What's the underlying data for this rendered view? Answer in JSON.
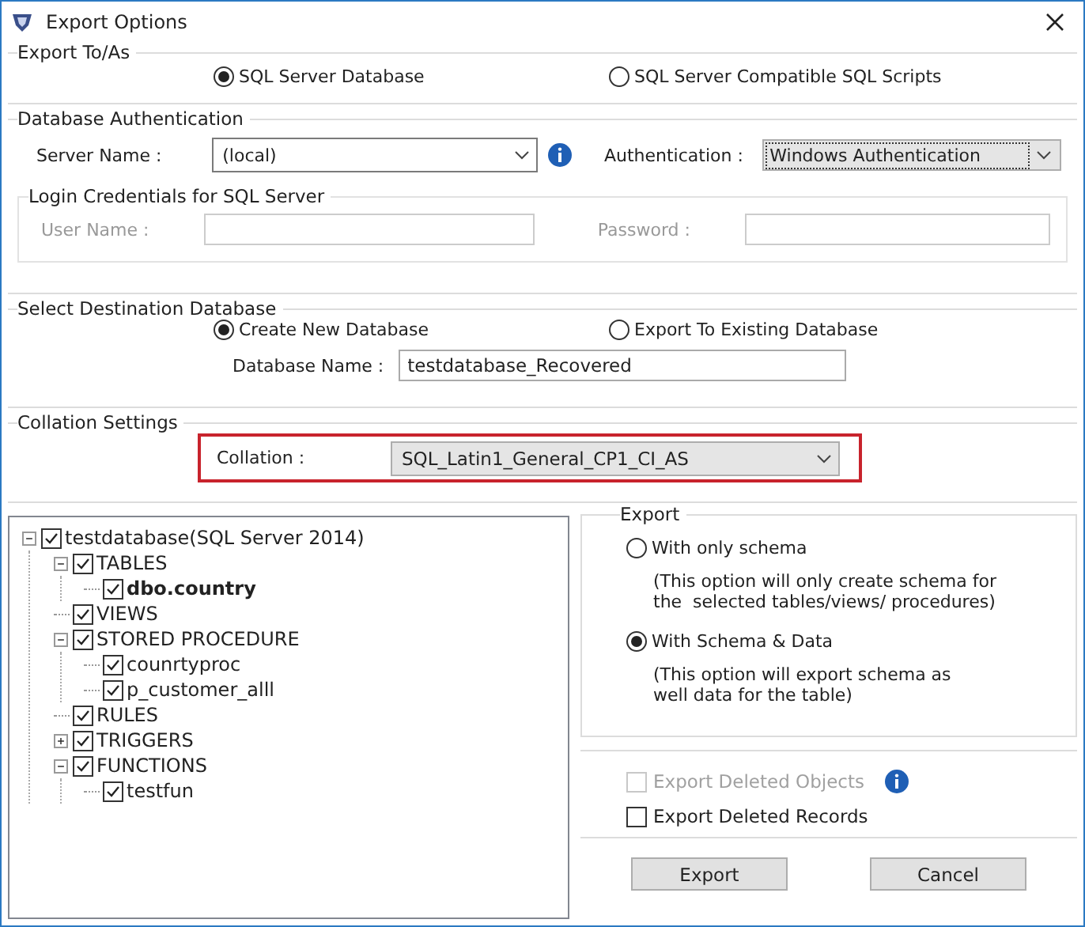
{
  "window": {
    "title": "Export Options"
  },
  "export_to": {
    "label": "Export To/As",
    "options": [
      {
        "label": "SQL Server Database",
        "selected": true
      },
      {
        "label": "SQL Server Compatible SQL Scripts",
        "selected": false
      }
    ]
  },
  "authentication": {
    "label": "Database Authentication",
    "server_name": {
      "label": "Server Name :",
      "value": "(local)"
    },
    "mode": {
      "label": "Authentication :",
      "value": "Windows Authentication"
    },
    "login": {
      "label": "Login Credentials for SQL Server",
      "disabled": true,
      "user_name": {
        "label": "User Name :"
      },
      "password": {
        "label": "Password :"
      }
    }
  },
  "destination": {
    "label": "Select Destination Database",
    "options": [
      {
        "label": "Create New Database",
        "selected": true
      },
      {
        "label": "Export To Existing Database",
        "selected": false
      }
    ],
    "database_name": {
      "label": "Database Name :",
      "value": "testdatabase_Recovered"
    }
  },
  "collation": {
    "label": "Collation Settings",
    "field": {
      "label": "Collation :",
      "value": "SQL_Latin1_General_CP1_CI_AS",
      "highlighted": true
    }
  },
  "tree": [
    {
      "label": "testdatabase(SQL Server 2014)",
      "checked": true,
      "expanded": true,
      "children": [
        {
          "label": "TABLES",
          "checked": true,
          "expanded": true,
          "children": [
            {
              "label": "dbo.country",
              "checked": true,
              "emphasized": true
            }
          ]
        },
        {
          "label": "VIEWS",
          "checked": true
        },
        {
          "label": "STORED PROCEDURE",
          "checked": true,
          "expanded": true,
          "children": [
            {
              "label": "counrtyproc",
              "checked": true
            },
            {
              "label": "p_customer_alll",
              "checked": true
            }
          ]
        },
        {
          "label": "RULES",
          "checked": true
        },
        {
          "label": "TRIGGERS",
          "checked": true,
          "expanded": false
        },
        {
          "label": "FUNCTIONS",
          "checked": true,
          "expanded": true,
          "children": [
            {
              "label": "testfun",
              "checked": true
            }
          ]
        }
      ]
    }
  ],
  "export": {
    "label": "Export",
    "options": [
      {
        "label": "With only schema",
        "note": "(This option will only create schema for\nthe  selected tables/views/ procedures)",
        "selected": false
      },
      {
        "label": "With Schema & Data",
        "note": "(This option will export schema as\nwell data for the table)",
        "selected": true
      }
    ]
  },
  "deleted": [
    {
      "label": "Export Deleted Objects",
      "checked": false,
      "disabled": true,
      "info": true
    },
    {
      "label": "Export Deleted Records",
      "checked": false,
      "disabled": false
    }
  ],
  "buttons": [
    "Export",
    "Cancel"
  ]
}
